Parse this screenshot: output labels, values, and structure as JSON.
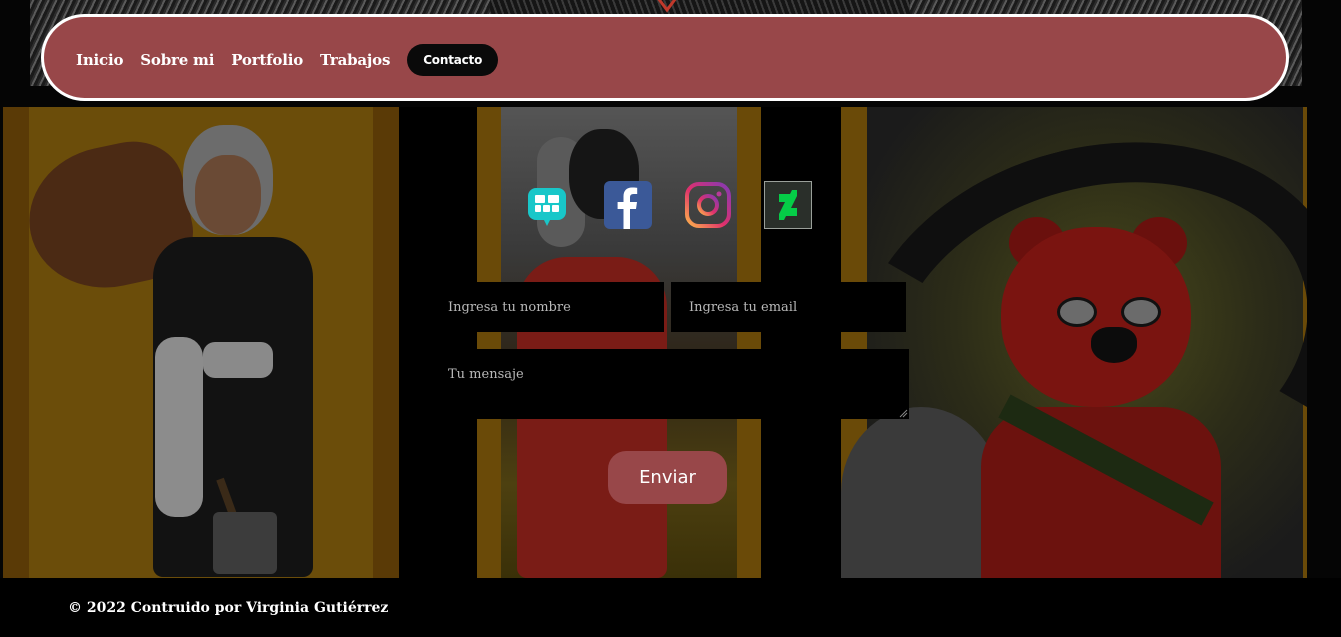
{
  "nav": {
    "items": [
      {
        "label": "Inicio",
        "active": false
      },
      {
        "label": "Sobre mi",
        "active": false
      },
      {
        "label": "Portfolio",
        "active": false
      },
      {
        "label": "Trabajos",
        "active": false
      },
      {
        "label": "Contacto",
        "active": true
      }
    ]
  },
  "social": [
    {
      "icon": "chat-icon"
    },
    {
      "icon": "facebook-icon"
    },
    {
      "icon": "instagram-icon"
    },
    {
      "icon": "deviantart-icon"
    }
  ],
  "form": {
    "name_placeholder": "Ingresa tu nombre",
    "email_placeholder": "Ingresa tu email",
    "message_placeholder": "Tu mensaje",
    "submit_label": "Enviar"
  },
  "footer": {
    "text": "© 2022 Contruido por Virginia Gutiérrez"
  },
  "colors": {
    "accent": "#984749",
    "background": "#000000",
    "text": "#ffffff"
  }
}
